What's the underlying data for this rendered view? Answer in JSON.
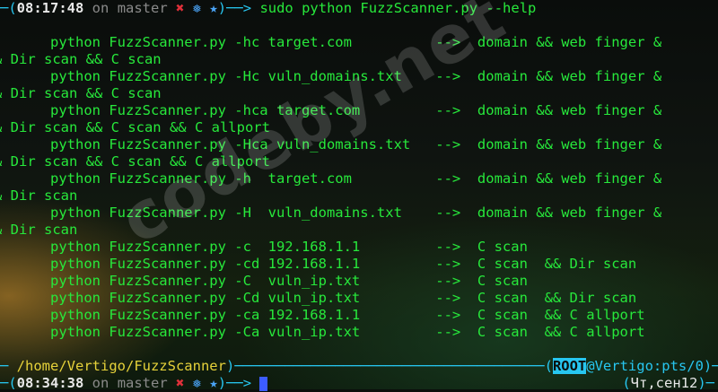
{
  "prompt_top": {
    "time": "08:17:48",
    "on": "on",
    "branch": "master",
    "marks": [
      "✖",
      "❅",
      "★"
    ],
    "arrow": "──>",
    "command": "sudo python FuzzScanner.py --help"
  },
  "help": [
    {
      "cmd": "      python FuzzScanner.py -hc target.com          -->  domain && web finger &",
      "cont": "& Dir scan && C scan"
    },
    {
      "cmd": "      python FuzzScanner.py -Hc vuln_domains.txt    -->  domain && web finger &",
      "cont": "& Dir scan && C scan"
    },
    {
      "cmd": "      python FuzzScanner.py -hca target.com         -->  domain && web finger &",
      "cont": "& Dir scan && C scan && C allport"
    },
    {
      "cmd": "      python FuzzScanner.py -Hca vuln_domains.txt   -->  domain && web finger &",
      "cont": "& Dir scan && C scan && C allport"
    },
    {
      "cmd": "      python FuzzScanner.py -h  target.com          -->  domain && web finger &",
      "cont": "& Dir scan"
    },
    {
      "cmd": "      python FuzzScanner.py -H  vuln_domains.txt    -->  domain && web finger &",
      "cont": "& Dir scan"
    },
    {
      "cmd": "      python FuzzScanner.py -c  192.168.1.1         -->  C scan",
      "cont": null
    },
    {
      "cmd": "      python FuzzScanner.py -cd 192.168.1.1         -->  C scan  && Dir scan",
      "cont": null
    },
    {
      "cmd": "      python FuzzScanner.py -C  vuln_ip.txt         -->  C scan",
      "cont": null
    },
    {
      "cmd": "      python FuzzScanner.py -Cd vuln_ip.txt         -->  C scan  && Dir scan",
      "cont": null
    },
    {
      "cmd": "      python FuzzScanner.py -ca 192.168.1.1         -->  C scan  && C allport",
      "cont": null
    },
    {
      "cmd": "      python FuzzScanner.py -Ca vuln_ip.txt         -->  C scan  && C allport",
      "cont": null
    }
  ],
  "status_bar": {
    "left_prefix": "─ ",
    "path": "/home/Vertigo/FuzzScanner",
    "fill": "─────────────────────────",
    "user": "ROOT",
    "host": "@Vertigo:pts/0"
  },
  "prompt_bottom": {
    "time": "08:34:38",
    "on": "on",
    "branch": "master",
    "marks": [
      "✖",
      "❅",
      "★"
    ],
    "arrow": "──>",
    "date": "Чт,сен12"
  },
  "watermark": "codeby.net",
  "colors": {
    "text_green": "#27e83b",
    "cyan": "#27c6f0",
    "red": "#e0303a",
    "cursor": "#3c5cff"
  }
}
